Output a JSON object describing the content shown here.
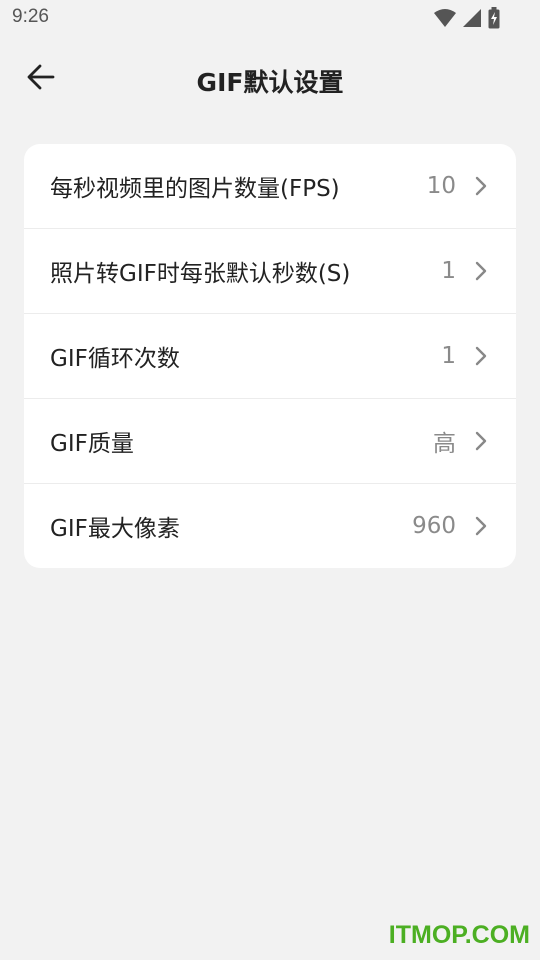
{
  "status_bar": {
    "time": "9:26",
    "icons": [
      "wifi-icon",
      "cellular-signal-icon",
      "battery-charging-icon"
    ]
  },
  "app_bar": {
    "back_icon": "arrow-left-icon",
    "title": "GIF默认设置"
  },
  "settings": [
    {
      "label": "每秒视频里的图片数量(FPS)",
      "value": "10"
    },
    {
      "label": "照片转GIF时每张默认秒数(S)",
      "value": "1"
    },
    {
      "label": "GIF循环次数",
      "value": "1"
    },
    {
      "label": "GIF质量",
      "value": "高"
    },
    {
      "label": "GIF最大像素",
      "value": "960"
    }
  ],
  "watermark": "ITMOP.COM",
  "colors": {
    "background": "#f2f2f2",
    "card": "#ffffff",
    "value_text": "#8a8a8a",
    "watermark": "#4caf23"
  }
}
